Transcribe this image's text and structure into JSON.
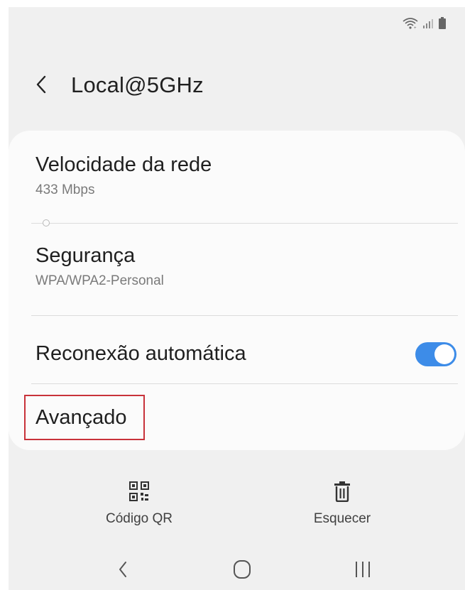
{
  "status_bar": {
    "icons": [
      "wifi-icon",
      "signal-icon",
      "battery-icon"
    ]
  },
  "header": {
    "back_icon": "chevron-left-icon",
    "title": "Local@5GHz"
  },
  "details": {
    "speed": {
      "label": "Velocidade da rede",
      "value": "433 Mbps"
    },
    "security": {
      "label": "Segurança",
      "value": "WPA/WPA2-Personal"
    },
    "auto_reconnect": {
      "label": "Reconexão automática",
      "enabled": true
    },
    "advanced": {
      "label": "Avançado"
    }
  },
  "actions": {
    "qr_code": {
      "label": "Código QR",
      "icon": "qr-code-icon"
    },
    "forget": {
      "label": "Esquecer",
      "icon": "trash-icon"
    }
  },
  "nav_bar": {
    "icons": [
      "nav-back-icon",
      "nav-home-icon",
      "nav-recents-icon"
    ]
  },
  "colors": {
    "accent": "#3d8ce8",
    "highlight_border": "#c8323a",
    "background": "#f0f0f0",
    "card": "#fbfbfb"
  }
}
